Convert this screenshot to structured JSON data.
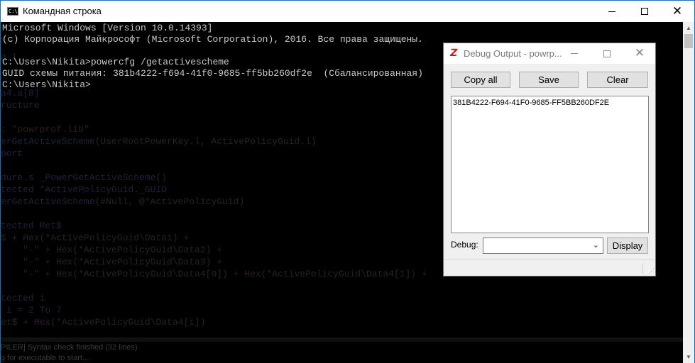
{
  "console": {
    "title": "Командная строка",
    "app_icon_text": "C:\\_",
    "lines": [
      "Microsoft Windows [Version 10.0.14393]",
      "(c) Корпорация Майкрософт (Microsoft Corporation), 2016. Все права защищены.",
      "",
      "C:\\Users\\Nikita>powercfg /getactivescheme",
      "GUID схемы питания: 381b4222-f694-41f0-9685-ff5bb260df2e  (Сбалансированная)",
      "C:\\Users\\Nikita>"
    ],
    "background_code": {
      "l1": "d.l",
      "l2": "a4.a[8]",
      "l3": "ructure",
      "l4": ": \"powrprof.lib\"",
      "l5a": "erGetActiveScheme",
      "l5b": "(UserRootPowerKey.l, ActivePolicyGuid.l)",
      "l6": "port",
      "l7a": "dure.s _PowerGetActiveScheme",
      "l7b": "()",
      "l8": "tected *ActivePolicyGuid._GUID",
      "l9a": "erGetActiveScheme",
      "l9b": "(#Null, @*ActivePolicyGuid)",
      "l10": "tected Ret$",
      "l11a": "$ + ",
      "l11b": "Hex",
      "l11c": "(*ActivePolicyGuid\\Data1) +",
      "l12a": "    \"-\"",
      "l12b": " + ",
      "l12c": "Hex",
      "l12d": "(*ActivePolicyGuid\\Data2) +",
      "l13a": "    \"-\"",
      "l13b": " + ",
      "l13c": "Hex",
      "l13d": "(*ActivePolicyGuid\\Data3) +",
      "l14a": "    \"-\"",
      "l14b": " + ",
      "l14c": "Hex",
      "l14d": "(*ActivePolicyGuid\\Data4[0]) + ",
      "l14e": "Hex",
      "l14f": "(*ActivePolicyGuid\\Data4[1]) + ",
      "l15": "tected i",
      "l16": " i = 2 To 7",
      "l17a": "et$ + ",
      "l17b": "Hex",
      "l17c": "(*ActivePolicyGuid\\Data4[i])",
      "status1": "PILER] Syntax check finished (32 lines)",
      "status2": "g for executable to start..."
    },
    "controls": {
      "minimize": "minimize",
      "maximize": "maximize",
      "close": "✕"
    }
  },
  "debug_window": {
    "title": "Debug Output - powrp...",
    "icon_glyph": "Z",
    "buttons": {
      "copy_all": "Copy all",
      "save": "Save",
      "clear": "Clear",
      "display": "Display"
    },
    "output_lines": [
      "381B4222-F694-41F0-9685-FF5BB260DF2E"
    ],
    "debug_label": "Debug:",
    "debug_select_value": "",
    "close_glyph": "✕",
    "resize_grip": "⋰"
  },
  "colors": {
    "console_bg": "#000000",
    "console_text": "#c8c8c8",
    "titlebar_bg": "#ffffff",
    "debug_bg": "#f0f0f0",
    "debug_icon": "#d2141e"
  }
}
